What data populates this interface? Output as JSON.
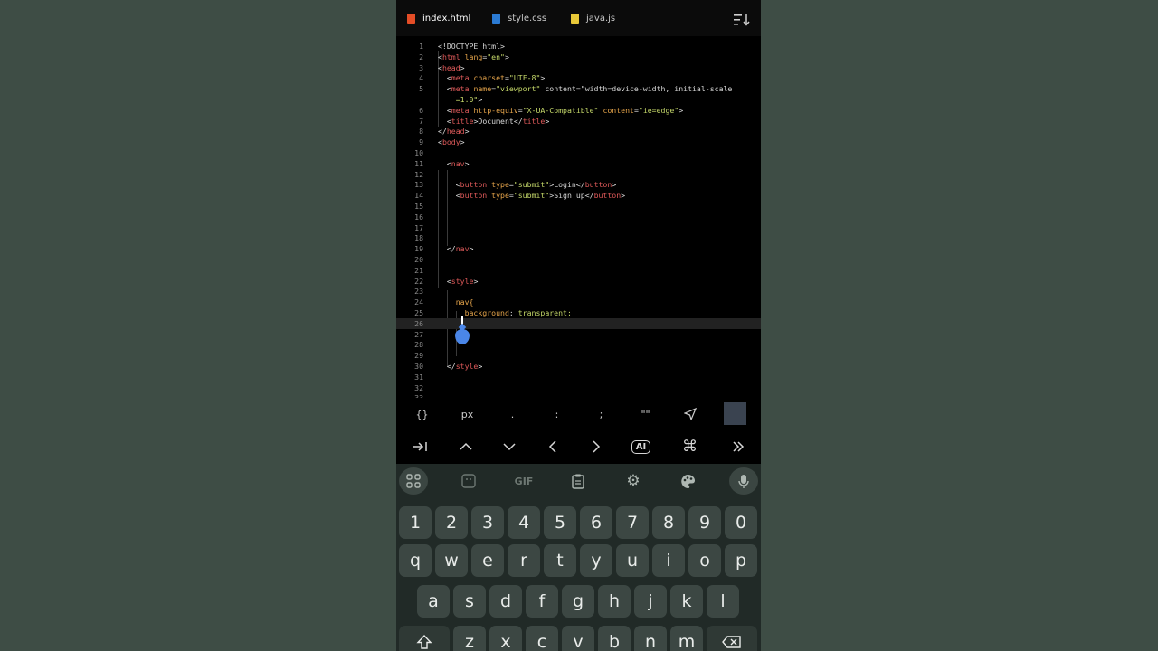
{
  "tabs": [
    {
      "label": "index.html",
      "active": true,
      "icon": "html-file-icon"
    },
    {
      "label": "style.css",
      "active": false,
      "icon": "css-file-icon"
    },
    {
      "label": "java.js",
      "active": false,
      "icon": "js-file-icon"
    }
  ],
  "editor": {
    "lines": [
      {
        "n": "1",
        "code": "<!DOCTYPE html>"
      },
      {
        "n": "2",
        "code": "<html lang=\"en\">"
      },
      {
        "n": "3",
        "code": "<head>"
      },
      {
        "n": "4",
        "code": "  <meta charset=\"UTF-8\">"
      },
      {
        "n": "5",
        "code": "  <meta name=\"viewport\" content=\"width=device-width, initial-scale"
      },
      {
        "n": "",
        "code": "    =1.0\">"
      },
      {
        "n": "6",
        "code": "  <meta http-equiv=\"X-UA-Compatible\" content=\"ie=edge\">"
      },
      {
        "n": "7",
        "code": "  <title>Document</title>"
      },
      {
        "n": "8",
        "code": "</head>"
      },
      {
        "n": "9",
        "code": "<body>"
      },
      {
        "n": "10",
        "code": ""
      },
      {
        "n": "11",
        "code": "  <nav>"
      },
      {
        "n": "12",
        "code": ""
      },
      {
        "n": "13",
        "code": "    <button type=\"submit\">Login</button>"
      },
      {
        "n": "14",
        "code": "    <button type=\"submit\">Sign up</button>"
      },
      {
        "n": "15",
        "code": ""
      },
      {
        "n": "16",
        "code": ""
      },
      {
        "n": "17",
        "code": ""
      },
      {
        "n": "18",
        "code": ""
      },
      {
        "n": "19",
        "code": "  </nav>"
      },
      {
        "n": "20",
        "code": ""
      },
      {
        "n": "21",
        "code": ""
      },
      {
        "n": "22",
        "code": "  <style>"
      },
      {
        "n": "23",
        "code": ""
      },
      {
        "n": "24",
        "code": "    nav{"
      },
      {
        "n": "25",
        "code": "      background: transparent;"
      },
      {
        "n": "26",
        "code": ""
      },
      {
        "n": "27",
        "code": ""
      },
      {
        "n": "28",
        "code": ""
      },
      {
        "n": "29",
        "code": ""
      },
      {
        "n": "30",
        "code": "  </style>"
      },
      {
        "n": "31",
        "code": ""
      },
      {
        "n": "32",
        "code": ""
      },
      {
        "n": "33",
        "code": ""
      }
    ],
    "current_line": "26"
  },
  "symbol_bar": [
    "{}",
    "px",
    ".",
    ":",
    ";",
    "\"\""
  ],
  "nav_bar": {
    "ai_label": "AI"
  },
  "keyboard": {
    "gif_label": "GIF",
    "numbers": [
      "1",
      "2",
      "3",
      "4",
      "5",
      "6",
      "7",
      "8",
      "9",
      "0"
    ],
    "row1": [
      "q",
      "w",
      "e",
      "r",
      "t",
      "y",
      "u",
      "i",
      "o",
      "p"
    ],
    "row2": [
      "a",
      "s",
      "d",
      "f",
      "g",
      "h",
      "j",
      "k",
      "l"
    ],
    "row3": [
      "z",
      "x",
      "c",
      "v",
      "b",
      "n",
      "m"
    ]
  }
}
